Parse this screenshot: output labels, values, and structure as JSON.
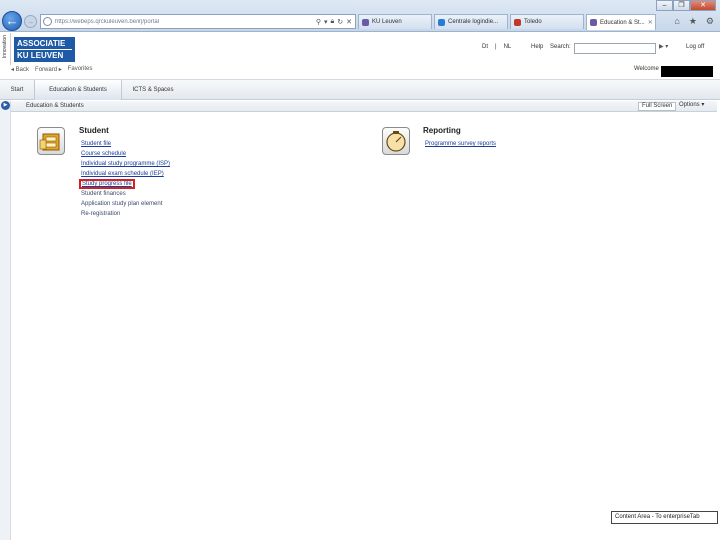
{
  "browser": {
    "url": "https://webeps.qrckuleuven.be/irj/portal",
    "tabs": [
      {
        "label": "KU Leuven",
        "icon": "ku-leuven-tab-icon",
        "color": "#6b5aa6"
      },
      {
        "label": "Centrale logindie...",
        "icon": "ie-tab-icon",
        "color": "#2a7ad8"
      },
      {
        "label": "Toledo",
        "icon": "toledo-tab-icon",
        "color": "#c0392b"
      },
      {
        "label": "Education & St...",
        "icon": "ku-leuven-tab-icon",
        "color": "#6b5aa6"
      }
    ],
    "window_buttons": {
      "minimize": "–",
      "restore": "❐",
      "close": "✕"
    },
    "tools": {
      "home": "⌂",
      "favorites": "★",
      "settings": "⚙"
    }
  },
  "portal": {
    "vertical_label": "Innovation",
    "logo": {
      "line1": "ASSOCIATIE",
      "line2": "KU LEUVEN"
    },
    "toplinks": {
      "lang": "Dt",
      "sep": "|",
      "lang2": "NL",
      "help": "Help"
    },
    "search_label": "Search:",
    "search_go": "▶ ▾",
    "logout": "Log off",
    "history": {
      "back": "◂ Back",
      "forward": "Forward ▸",
      "favorites": "Favorites"
    },
    "welcome_label": "Welcome"
  },
  "main_tabs": [
    "Start",
    "Education & Students",
    "ICTS & Spaces"
  ],
  "subbar": {
    "title": "Education & Students",
    "fullscreen": "Full Screen",
    "options": "Options ▾"
  },
  "sections": {
    "student": {
      "title": "Student",
      "links": [
        {
          "label": "Student file",
          "style": "link"
        },
        {
          "label": "Course schedule",
          "style": "link"
        },
        {
          "label": "Individual study programme (ISP)",
          "style": "link"
        },
        {
          "label": "Individual exam schedule (IEP)",
          "style": "link"
        },
        {
          "label": "Study progress file",
          "style": "highlight"
        },
        {
          "label": "Student finances",
          "style": "plain"
        },
        {
          "label": "Application study plan element",
          "style": "plain"
        },
        {
          "label": "Re-registration",
          "style": "plain"
        }
      ]
    },
    "reporting": {
      "title": "Reporting",
      "links": [
        {
          "label": "Programme survey reports",
          "style": "link"
        }
      ]
    }
  },
  "status_tooltip": "Content Area - To enterpriseTab"
}
